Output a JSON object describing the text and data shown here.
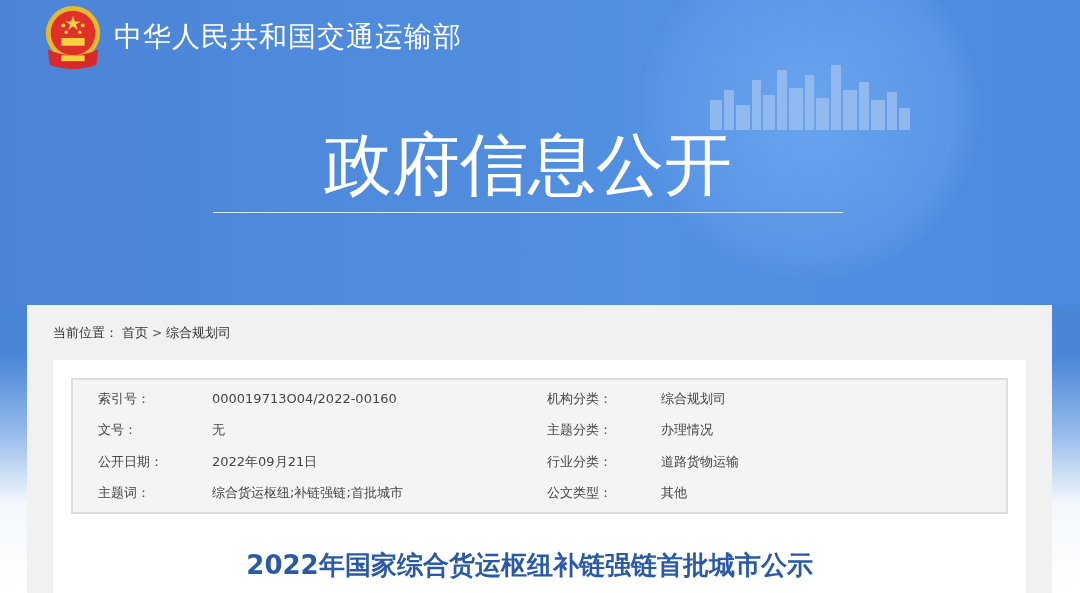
{
  "header": {
    "site_name": "中华人民共和国交通运输部",
    "banner_title": "政府信息公开"
  },
  "breadcrumb": {
    "label": "当前位置：",
    "separator": ">",
    "items": [
      "首页",
      "综合规划司"
    ]
  },
  "info_table": [
    {
      "label": "索引号：",
      "value": "000019713O04/2022-00160"
    },
    {
      "label": "机构分类：",
      "value": "综合规划司"
    },
    {
      "label": "文号：",
      "value": "无"
    },
    {
      "label": "主题分类：",
      "value": "办理情况"
    },
    {
      "label": "公开日期：",
      "value": "2022年09月21日"
    },
    {
      "label": "行业分类：",
      "value": "道路货物运输"
    },
    {
      "label": "主题词：",
      "value": "综合货运枢纽;补链强链;首批城市"
    },
    {
      "label": "公文类型：",
      "value": "其他"
    }
  ],
  "article_title": "2022年国家综合货运枢纽补链强链首批城市公示"
}
